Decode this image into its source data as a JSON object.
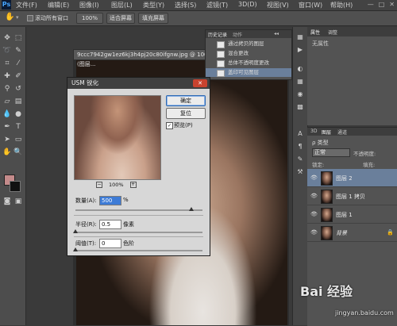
{
  "app": {
    "logo": "Ps"
  },
  "menu": [
    "文件(F)",
    "编辑(E)",
    "图像(I)",
    "图层(L)",
    "类型(Y)",
    "选择(S)",
    "滤镜(T)",
    "3D(D)",
    "视图(V)",
    "窗口(W)",
    "帮助(H)"
  ],
  "options": {
    "scroll_all": "滚动所有窗口",
    "zoom": "100%",
    "fit_screen": "适合屏幕",
    "fill_screen": "填充屏幕"
  },
  "document": {
    "tab_title": "9ccc7942gw1ez6kj3h4pj20c80ifgnw.jpg @ 100%(图层..."
  },
  "history": {
    "tabs": [
      "历史记录",
      "动作"
    ],
    "items": [
      "通过拷贝的图层",
      "混合更改",
      "总体不透明度更改",
      "盖印可见图层"
    ]
  },
  "properties": {
    "tabs": [
      "属性",
      "调整"
    ],
    "empty": "无属性"
  },
  "layers": {
    "tabs": [
      "3D",
      "图层",
      "通道"
    ],
    "kind_label": "ρ 类型",
    "blend_mode": "正常",
    "opacity_label": "不透明度:",
    "lock_label": "锁定:",
    "fill_label": "填充:",
    "items": [
      {
        "name": "图层 2",
        "selected": true
      },
      {
        "name": "图层 1 拷贝",
        "selected": false
      },
      {
        "name": "图层 1",
        "selected": false
      },
      {
        "name": "背景",
        "selected": false
      }
    ]
  },
  "usm": {
    "title": "USM 锐化",
    "ok": "确定",
    "reset": "复位",
    "preview_label": "预览(P)",
    "preview_checked": true,
    "zoom": "100%",
    "amount_label": "数量(A):",
    "amount_value": "500",
    "amount_unit": "%",
    "amount_level": 0.97,
    "radius_label": "半径(R):",
    "radius_value": "0.5",
    "radius_unit": "像素",
    "radius_level": 0.0,
    "threshold_label": "阈值(T):",
    "threshold_value": "0",
    "threshold_unit": "色阶",
    "threshold_level": 0.0
  },
  "watermark": {
    "main": "Bai 经验",
    "sub": "jingyan.baidu.com"
  },
  "colors": {
    "accent": "#6a7f9b",
    "fg_swatch": "#c48b8b",
    "bg_swatch": "#111111"
  }
}
